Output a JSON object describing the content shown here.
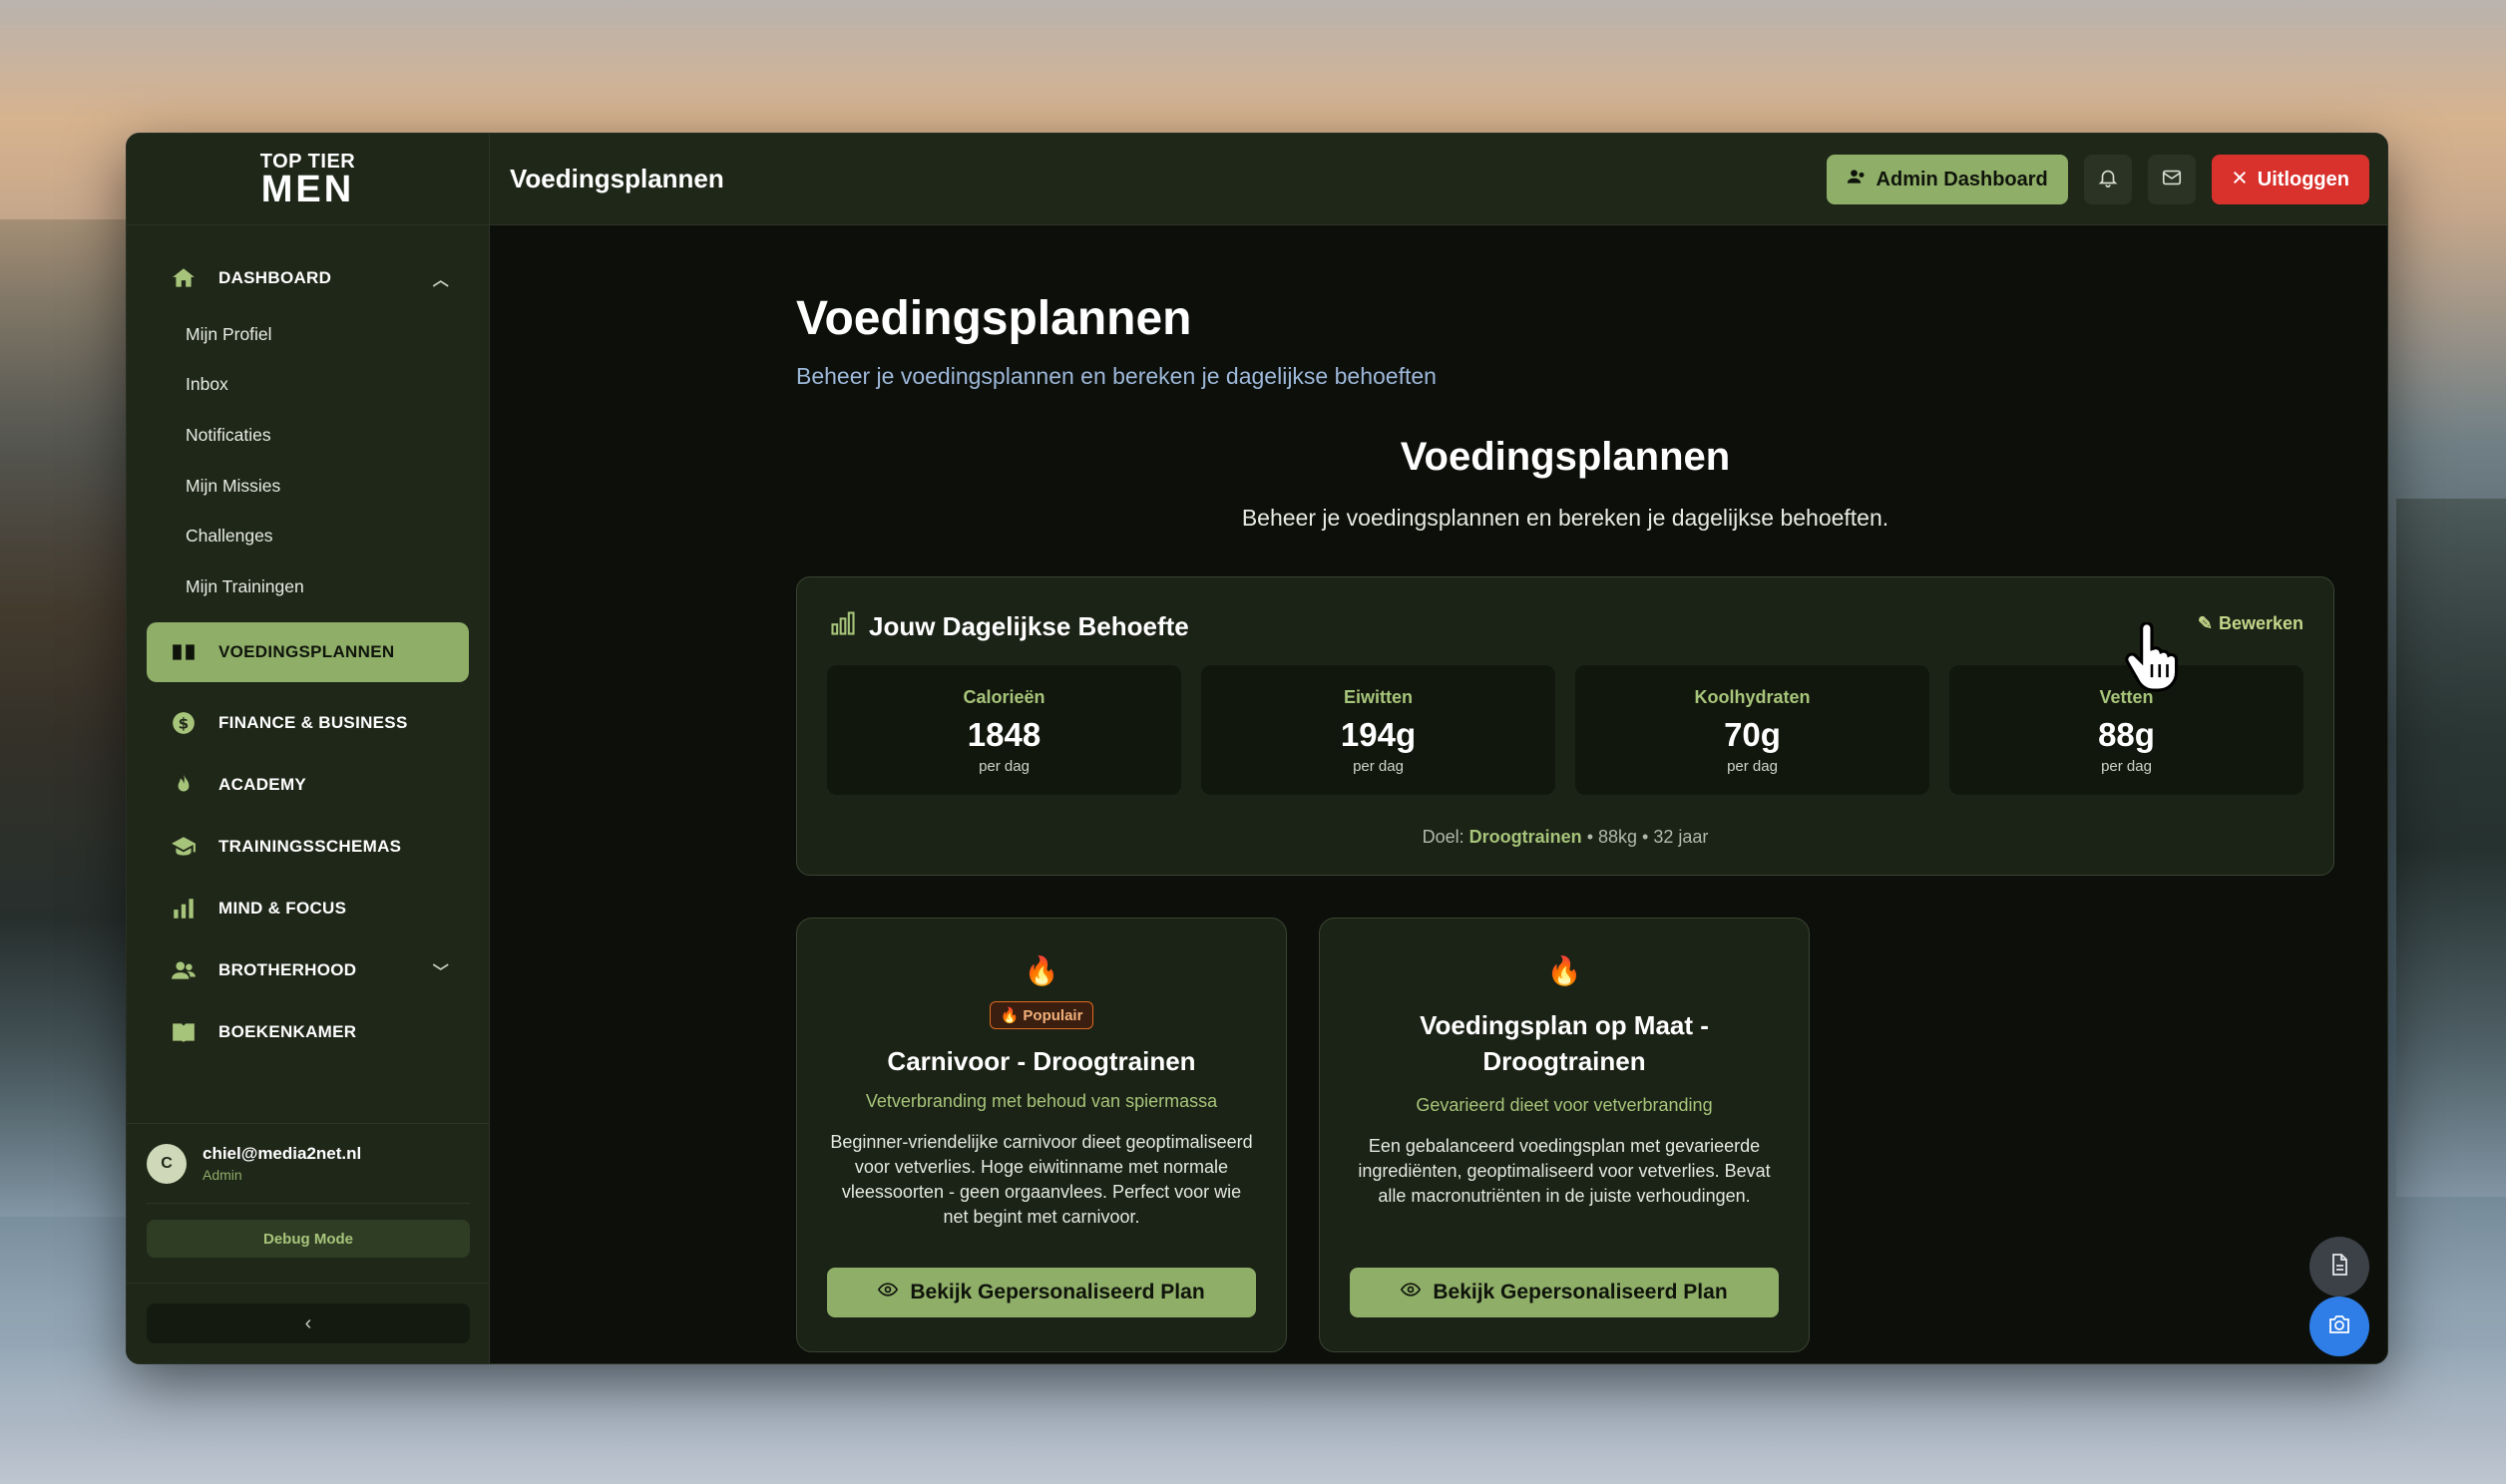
{
  "brand": {
    "top": "TOP TIER",
    "big": "MEN"
  },
  "topbar": {
    "title": "Voedingsplannen",
    "admin_label": "Admin Dashboard",
    "logout_label": "Uitloggen"
  },
  "sidebar": {
    "dashboard": "DASHBOARD",
    "sub_items": [
      "Mijn Profiel",
      "Inbox",
      "Notificaties",
      "Mijn Missies",
      "Challenges",
      "Mijn Trainingen"
    ],
    "items": [
      "VOEDINGSPLANNEN",
      "FINANCE & BUSINESS",
      "ACADEMY",
      "TRAININGSSCHEMAS",
      "MIND & FOCUS",
      "BROTHERHOOD",
      "BOEKENKAMER"
    ],
    "user": {
      "initial": "C",
      "email": "chiel@media2net.nl",
      "role": "Admin"
    },
    "debug_label": "Debug Mode",
    "collapse_glyph": "‹"
  },
  "page": {
    "title": "Voedingsplannen",
    "subtitle": "Beheer je voedingsplannen en bereken je dagelijkse behoeften",
    "section_title": "Voedingsplannen",
    "section_subtitle": "Beheer je voedingsplannen en bereken je dagelijkse behoeften."
  },
  "needs": {
    "title": "Jouw Dagelijkse Behoefte",
    "edit_label": "Bewerken",
    "stats": [
      {
        "label": "Calorieën",
        "value": "1848",
        "unit": "per dag"
      },
      {
        "label": "Eiwitten",
        "value": "194g",
        "unit": "per dag"
      },
      {
        "label": "Koolhydraten",
        "value": "70g",
        "unit": "per dag"
      },
      {
        "label": "Vetten",
        "value": "88g",
        "unit": "per dag"
      }
    ],
    "goal_prefix": "Doel:",
    "goal": "Droogtrainen",
    "goal_rest": "• 88kg • 32 jaar"
  },
  "cards": [
    {
      "badge": "Populair",
      "title": "Carnivoor - Droogtrainen",
      "subtitle": "Vetverbranding met behoud van spiermassa",
      "description": "Beginner-vriendelijke carnivoor dieet geoptimaliseerd voor vetverlies. Hoge eiwitinname met normale vleessoorten - geen orgaanvlees. Perfect voor wie net begint met carnivoor.",
      "button": "Bekijk Gepersonaliseerd Plan"
    },
    {
      "title": "Voedingsplan op Maat - Droogtrainen",
      "subtitle": "Gevarieerd dieet voor vetverbranding",
      "description": "Een gebalanceerd voedingsplan met gevarieerde ingrediënten, geoptimaliseerd voor vetverlies. Bevat alle macronutriënten in de juiste verhoudingen.",
      "button": "Bekijk Gepersonaliseerd Plan"
    }
  ],
  "colors": {
    "accent": "#8fae68",
    "danger": "#d9312c",
    "sidebar": "#1f2719",
    "camera": "#2f7ee8"
  }
}
